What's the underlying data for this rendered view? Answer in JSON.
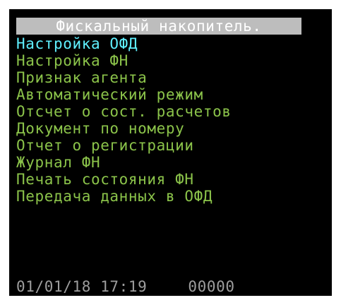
{
  "colors": {
    "background": "#000000",
    "title_background": "#bdbdbd",
    "title_text": "#ffffff",
    "menu_item": "#8bc34a",
    "menu_item_selected": "#5ff0ff",
    "status_text": "#9e9e9e"
  },
  "title": "Фискальный накопитель.",
  "menu": {
    "selected_index": 0,
    "items": [
      {
        "label": "Настройка ОФД"
      },
      {
        "label": "Настройка ФН"
      },
      {
        "label": "Признак агента"
      },
      {
        "label": "Автоматический режим"
      },
      {
        "label": "Отсчет о сост. расчетов"
      },
      {
        "label": "Документ по номеру"
      },
      {
        "label": "Отчет о регистрации"
      },
      {
        "label": "Журнал ФН"
      },
      {
        "label": "Печать состояния ФН"
      },
      {
        "label": "Передача данных в ОФД"
      }
    ]
  },
  "status": {
    "datetime": "01/01/18 17:19",
    "counter": "00000"
  }
}
